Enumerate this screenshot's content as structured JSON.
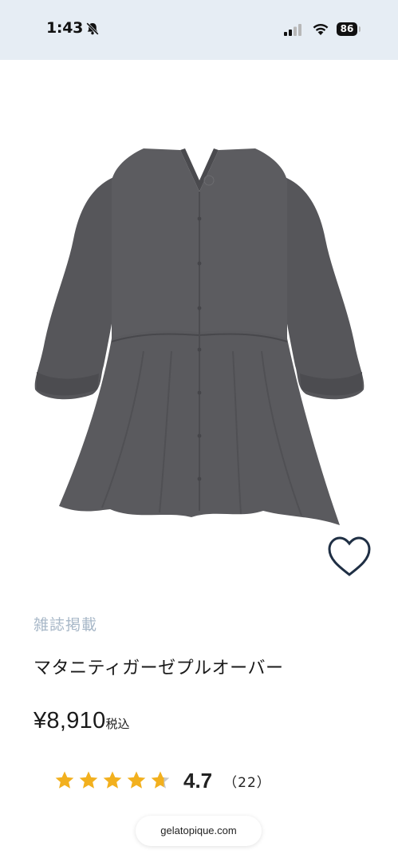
{
  "status_bar": {
    "time": "1:43",
    "battery": "86",
    "icons": [
      "bell-slash-icon",
      "cellular-signal-icon",
      "wifi-icon",
      "battery-icon"
    ]
  },
  "product": {
    "image_icon": "gauze-peplum-pullover-image",
    "tag": "雑誌掲載",
    "name": "マタニティガーゼプルオーバー",
    "price": "¥8,910",
    "tax_label": "税込",
    "rating": {
      "stars": 4.7,
      "max": 5,
      "value_text": "4.7",
      "count_text": "（22）"
    },
    "favorite_icon": "heart-outline-icon"
  },
  "browser": {
    "url": "gelatopique.com"
  },
  "colors": {
    "status_bar_bg": "#e6edf4",
    "garment": "#5a5a5e",
    "heart_stroke": "#1f2f44",
    "star_fill": "#f2b01e",
    "star_empty": "#c8c8c8",
    "tag_text": "#a8b8c8"
  }
}
